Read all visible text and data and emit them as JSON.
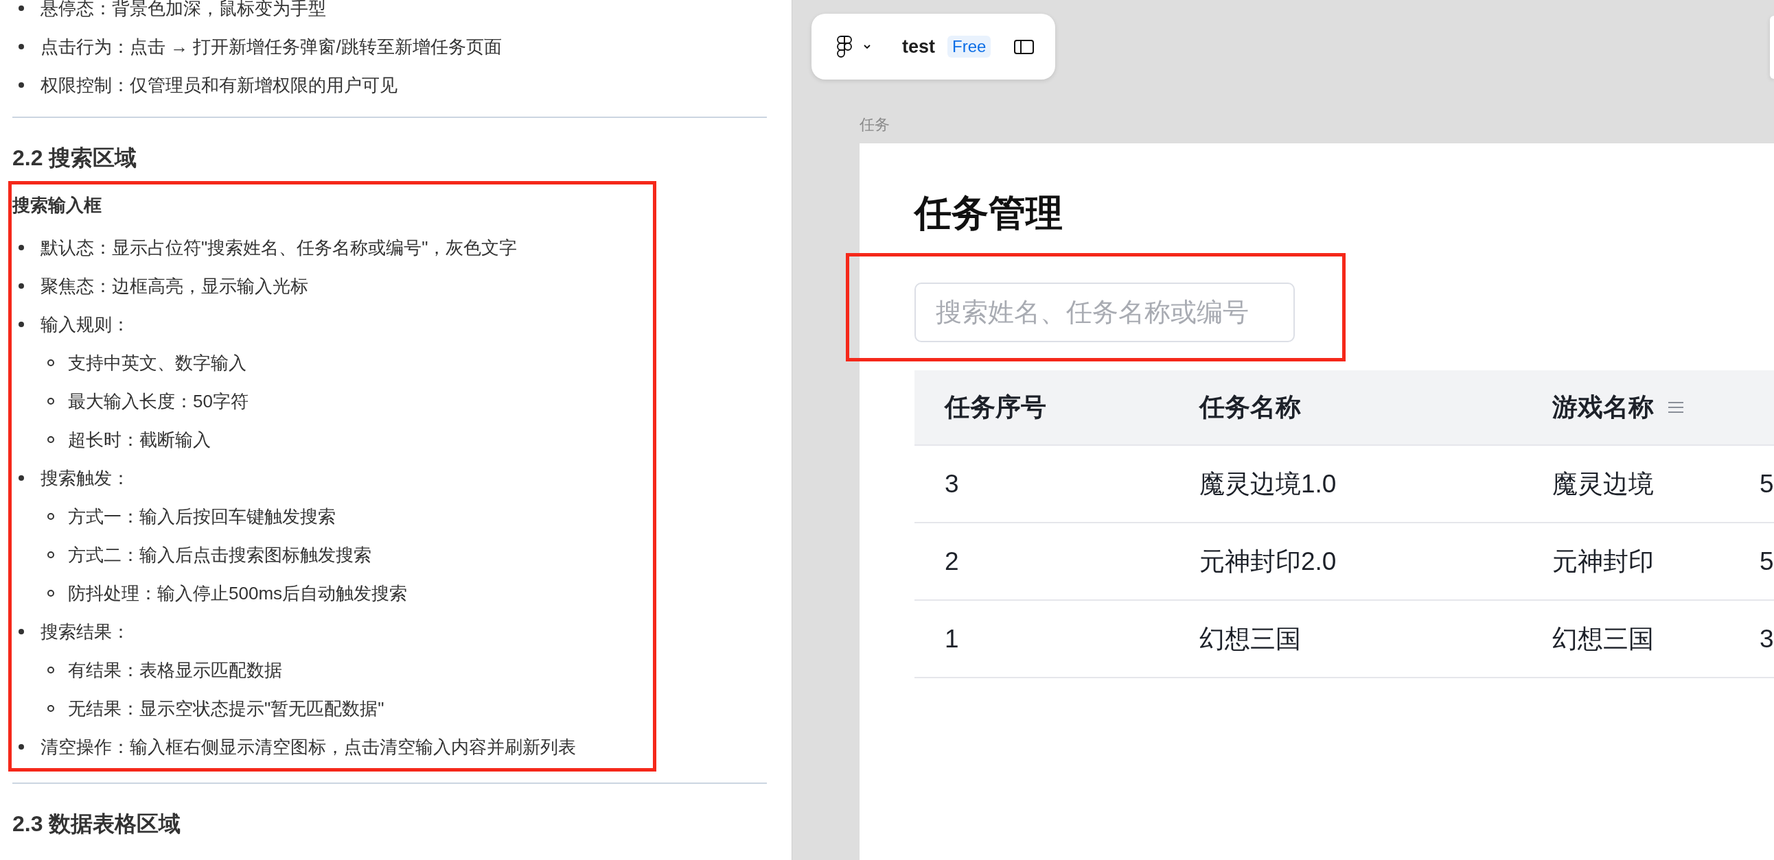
{
  "document": {
    "blocks": [
      {
        "kind": "list",
        "items": [
          {
            "text": "悬停态：背景色加深，鼠标变为手型"
          },
          {
            "text": "点击行为：点击 → 打开新增任务弹窗/跳转至新增任务页面"
          },
          {
            "text": "权限控制：仅管理员和有新增权限的用户可见"
          }
        ]
      },
      {
        "kind": "rule"
      },
      {
        "kind": "heading",
        "text": "2.2 搜索区域"
      },
      {
        "kind": "highlight",
        "blocks": [
          {
            "kind": "subheading",
            "text": "搜索输入框"
          },
          {
            "kind": "list",
            "items": [
              {
                "text": "默认态：显示占位符\"搜索姓名、任务名称或编号\"，灰色文字"
              },
              {
                "text": "聚焦态：边框高亮，显示输入光标"
              },
              {
                "text": "输入规则：",
                "children": [
                  {
                    "text": "支持中英文、数字输入"
                  },
                  {
                    "text": "最大输入长度：50字符"
                  },
                  {
                    "text": "超长时：截断输入"
                  }
                ]
              },
              {
                "text": "搜索触发：",
                "children": [
                  {
                    "text": "方式一：输入后按回车键触发搜索"
                  },
                  {
                    "text": "方式二：输入后点击搜索图标触发搜索"
                  },
                  {
                    "text": "防抖处理：输入停止500ms后自动触发搜索"
                  }
                ]
              },
              {
                "text": "搜索结果：",
                "children": [
                  {
                    "text": "有结果：表格显示匹配数据"
                  },
                  {
                    "text": "无结果：显示空状态提示\"暂无匹配数据\""
                  }
                ]
              },
              {
                "text": "清空操作：输入框右侧显示清空图标，点击清空输入内容并刷新列表"
              }
            ]
          }
        ]
      },
      {
        "kind": "rule"
      },
      {
        "kind": "heading",
        "text": "2.3 数据表格区域"
      }
    ]
  },
  "toolbar": {
    "file_name": "test",
    "plan_badge": "Free"
  },
  "frame": {
    "label": "任务",
    "title": "任务管理",
    "search": {
      "placeholder": "搜索姓名、任务名称或编号",
      "highlighted": true
    },
    "table": {
      "columns": [
        {
          "label": "任务序号",
          "menu": false
        },
        {
          "label": "任务名称",
          "menu": false
        },
        {
          "label": "游戏名称",
          "menu": true
        }
      ],
      "rows": [
        [
          "3",
          "魔灵边境1.0",
          "魔灵边境",
          "5"
        ],
        [
          "2",
          "元神封印2.0",
          "元神封印",
          "5"
        ],
        [
          "1",
          "幻想三国",
          "幻想三国",
          "3"
        ]
      ]
    }
  }
}
